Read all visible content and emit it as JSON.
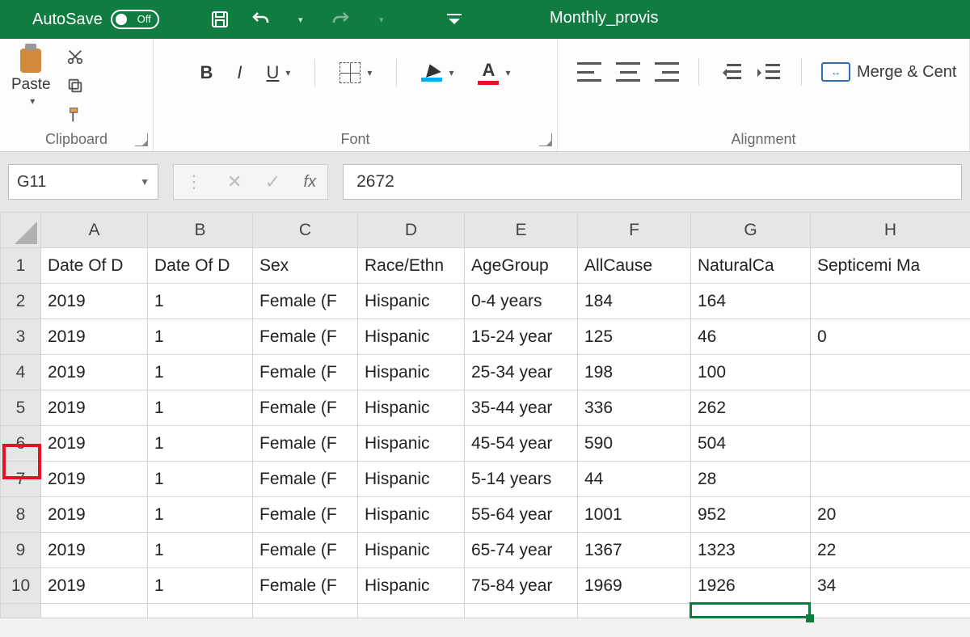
{
  "titlebar": {
    "autosave_label": "AutoSave",
    "autosave_state": "Off",
    "document_title": "Monthly_provis"
  },
  "ribbon": {
    "clipboard": {
      "label": "Clipboard",
      "paste_label": "Paste"
    },
    "font": {
      "label": "Font",
      "bold": "B",
      "italic": "I",
      "underline": "U",
      "font_color_letter": "A"
    },
    "alignment": {
      "label": "Alignment",
      "merge_label": "Merge & Cent"
    }
  },
  "namebox": {
    "ref": "G11"
  },
  "formula": {
    "fx_label": "fx",
    "value": "2672"
  },
  "columns": [
    "A",
    "B",
    "C",
    "D",
    "E",
    "F",
    "G",
    "H"
  ],
  "headers": {
    "A": "Date Of D",
    "B": "Date Of D",
    "C": "Sex",
    "D": "Race/Ethn",
    "E": "AgeGroup",
    "F": "AllCause",
    "G": "NaturalCa",
    "H": "Septicemi Ma"
  },
  "rows": [
    {
      "n": 2,
      "A": "2019",
      "B": "1",
      "C": "Female (F",
      "D": "Hispanic",
      "E": "0-4 years",
      "F": "184",
      "G": "164",
      "H": ""
    },
    {
      "n": 3,
      "A": "2019",
      "B": "1",
      "C": "Female (F",
      "D": "Hispanic",
      "E": "15-24 year",
      "F": "125",
      "G": "46",
      "H": "0"
    },
    {
      "n": 4,
      "A": "2019",
      "B": "1",
      "C": "Female (F",
      "D": "Hispanic",
      "E": "25-34 year",
      "F": "198",
      "G": "100",
      "H": ""
    },
    {
      "n": 5,
      "A": "2019",
      "B": "1",
      "C": "Female (F",
      "D": "Hispanic",
      "E": "35-44 year",
      "F": "336",
      "G": "262",
      "H": ""
    },
    {
      "n": 6,
      "A": "2019",
      "B": "1",
      "C": "Female (F",
      "D": "Hispanic",
      "E": "45-54 year",
      "F": "590",
      "G": "504",
      "H": ""
    },
    {
      "n": 7,
      "A": "2019",
      "B": "1",
      "C": "Female (F",
      "D": "Hispanic",
      "E": "5-14 years",
      "F": "44",
      "G": "28",
      "H": ""
    },
    {
      "n": 8,
      "A": "2019",
      "B": "1",
      "C": "Female (F",
      "D": "Hispanic",
      "E": "55-64 year",
      "F": "1001",
      "G": "952",
      "H": "20"
    },
    {
      "n": 9,
      "A": "2019",
      "B": "1",
      "C": "Female (F",
      "D": "Hispanic",
      "E": "65-74 year",
      "F": "1367",
      "G": "1323",
      "H": "22"
    },
    {
      "n": 10,
      "A": "2019",
      "B": "1",
      "C": "Female (F",
      "D": "Hispanic",
      "E": "75-84 year",
      "F": "1969",
      "G": "1926",
      "H": "34"
    }
  ],
  "active_cell": "G11"
}
